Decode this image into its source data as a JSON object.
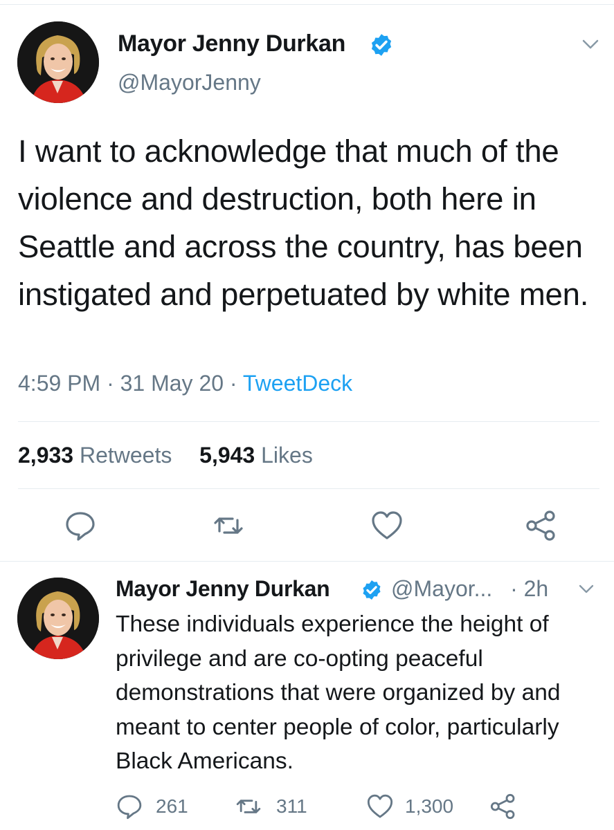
{
  "main_tweet": {
    "author_name": "Mayor Jenny Durkan",
    "handle": "@MayorJenny",
    "text": "I want to acknowledge that much of the violence and destruction, both here in Seattle and across the country, has been instigated and perpetuated by white men.",
    "time": "4:59 PM",
    "separator": "·",
    "date": "31 May 20",
    "source": "TweetDeck",
    "retweets_count": "2,933",
    "retweets_label": "Retweets",
    "likes_count": "5,943",
    "likes_label": "Likes",
    "icons": [
      "avatar-photo",
      "verified-badge-icon",
      "chevron-down-icon",
      "reply-icon",
      "retweet-icon",
      "like-icon",
      "share-icon"
    ]
  },
  "reply_tweet": {
    "author_name": "Mayor Jenny Durkan",
    "handle": "@Mayor...",
    "separator": "·",
    "age": "2h",
    "text": "These individuals experience the height of privilege and are co-opting peaceful demonstrations that were organized by and meant to center people of color, particularly Black Americans.",
    "reply_count": "261",
    "retweet_count": "311",
    "like_count": "1,300"
  },
  "colors": {
    "text": "#14171a",
    "secondary": "#657786",
    "link": "#1da1f2",
    "divider": "#e6ecf0",
    "verified": "#1da1f2"
  }
}
